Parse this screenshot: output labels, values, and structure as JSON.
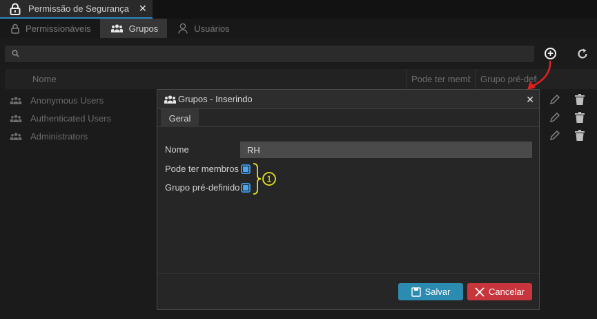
{
  "window_tab": {
    "title": "Permissão de Segurança",
    "close": "✕"
  },
  "subtabs": [
    {
      "label": "Permissionáveis",
      "icon": "lock-icon"
    },
    {
      "label": "Grupos",
      "icon": "users-icon",
      "active": true
    },
    {
      "label": "Usuários",
      "icon": "user-icon"
    }
  ],
  "search": {
    "placeholder": "",
    "value": ""
  },
  "toolbar": {
    "add_icon": "plus-circle-icon",
    "refresh_icon": "refresh-icon"
  },
  "table": {
    "columns": [
      "Nome",
      "Pode ter membros",
      "Grupo pré-definido"
    ],
    "rows": [
      {
        "name": "Anonymous Users"
      },
      {
        "name": "Authenticated Users"
      },
      {
        "name": "Administrators"
      }
    ]
  },
  "modal": {
    "title": "Grupos - Inserindo",
    "close": "✕",
    "tab": "Geral",
    "fields": {
      "name_label": "Nome",
      "name_value": "RH",
      "members_label": "Pode ter membros",
      "members_checked": true,
      "predef_label": "Grupo pré-definido",
      "predef_checked": true
    },
    "annotation_number": "1",
    "save_label": "Salvar",
    "cancel_label": "Cancelar"
  },
  "colors": {
    "accent": "#2e86c1",
    "save": "#2b8bb0",
    "cancel": "#c8363d",
    "annotation": "#e6e61e",
    "arrow": "#e02020"
  }
}
